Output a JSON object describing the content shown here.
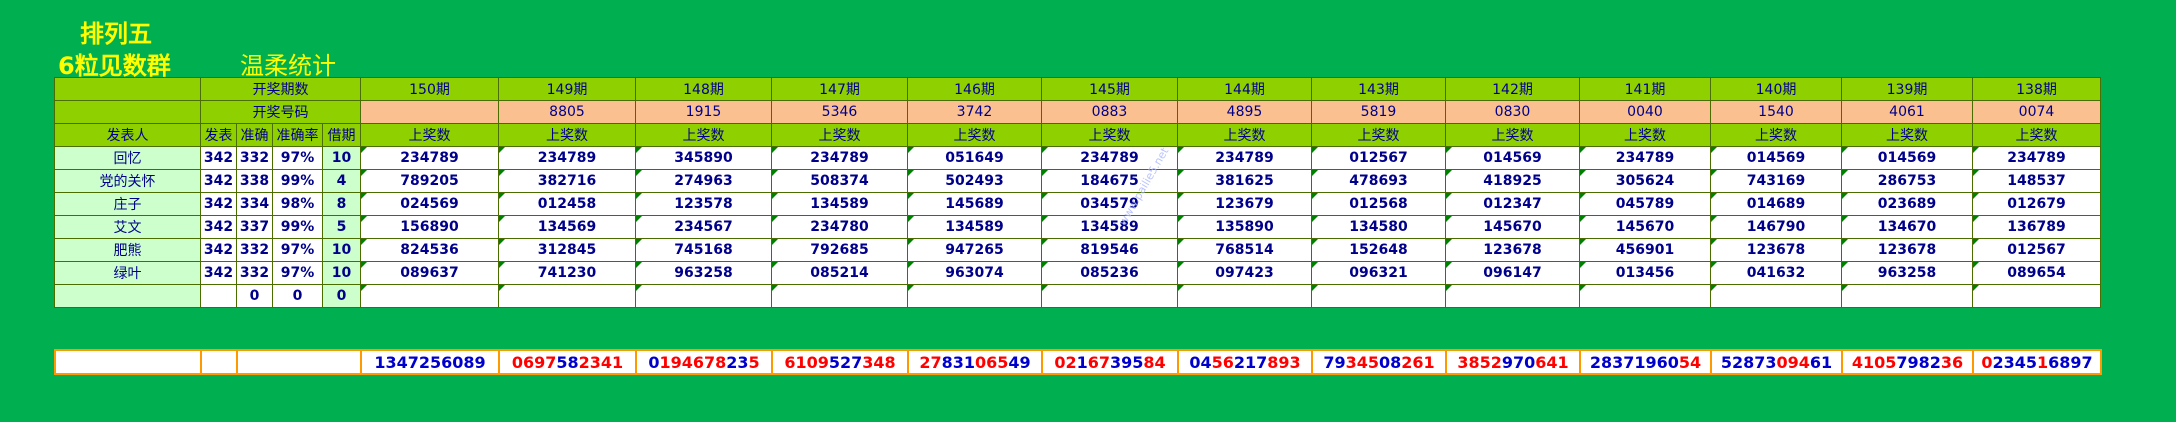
{
  "titles": {
    "main": "排列五",
    "sub": "6粒见数群",
    "tagline": "温柔统计"
  },
  "table": {
    "label_period": "开奖期数",
    "label_number": "开奖号码",
    "label_publisher": "发表人",
    "stat_headers": [
      "发表",
      "准确",
      "准确率",
      "借期"
    ],
    "prize_label": "上奖数",
    "periods": [
      "150期",
      "149期",
      "148期",
      "147期",
      "146期",
      "145期",
      "144期",
      "143期",
      "142期",
      "141期",
      "140期",
      "139期",
      "138期"
    ],
    "draws": [
      "",
      "8805",
      "1915",
      "5346",
      "3742",
      "0883",
      "4895",
      "5819",
      "0830",
      "0040",
      "1540",
      "4061",
      "0074"
    ],
    "rows": [
      {
        "name": "回忆",
        "stats": [
          "342",
          "332",
          "97%",
          "10"
        ],
        "preds": [
          "234789",
          "234789",
          "345890",
          "234789",
          "051649",
          "234789",
          "234789",
          "012567",
          "014569",
          "234789",
          "014569",
          "014569",
          "234789"
        ]
      },
      {
        "name": "党的关怀",
        "stats": [
          "342",
          "338",
          "99%",
          "4"
        ],
        "preds": [
          "789205",
          "382716",
          "274963",
          "508374",
          "502493",
          "184675",
          "381625",
          "478693",
          "418925",
          "305624",
          "743169",
          "286753",
          "148537"
        ]
      },
      {
        "name": "庄子",
        "stats": [
          "342",
          "334",
          "98%",
          "8"
        ],
        "preds": [
          "024569",
          "012458",
          "123578",
          "134589",
          "145689",
          "034579",
          "123679",
          "012568",
          "012347",
          "045789",
          "014689",
          "023689",
          "012679"
        ]
      },
      {
        "name": "艾文",
        "stats": [
          "342",
          "337",
          "99%",
          "5"
        ],
        "preds": [
          "156890",
          "134569",
          "234567",
          "234780",
          "134589",
          "134589",
          "135890",
          "134580",
          "145670",
          "145670",
          "146790",
          "134670",
          "136789"
        ]
      },
      {
        "name": "肥熊",
        "stats": [
          "342",
          "332",
          "97%",
          "10"
        ],
        "preds": [
          "824536",
          "312845",
          "745168",
          "792685",
          "947265",
          "819546",
          "768514",
          "152648",
          "123678",
          "456901",
          "123678",
          "123678",
          "012567"
        ]
      },
      {
        "name": "绿叶",
        "stats": [
          "342",
          "332",
          "97%",
          "10"
        ],
        "preds": [
          "089637",
          "741230",
          "963258",
          "085214",
          "963074",
          "085236",
          "097423",
          "096321",
          "096147",
          "013456",
          "041632",
          "963258",
          "089654"
        ]
      },
      {
        "name": "",
        "stats": [
          "",
          "0",
          "0",
          "0"
        ],
        "preds": [
          "",
          "",
          "",
          "",
          "",
          "",
          "",
          "",
          "",
          "",
          "",
          "",
          ""
        ]
      }
    ]
  },
  "bottom": {
    "sequences": [
      [
        {
          "t": "1347256089",
          "c": "b"
        }
      ],
      [
        {
          "t": "0697",
          "c": "r"
        },
        {
          "t": "58",
          "c": "b"
        },
        {
          "t": "2341",
          "c": "r"
        }
      ],
      [
        {
          "t": "0",
          "c": "b"
        },
        {
          "t": "194678",
          "c": "r"
        },
        {
          "t": "23",
          "c": "b"
        },
        {
          "t": "5",
          "c": "r"
        }
      ],
      [
        {
          "t": "6109",
          "c": "r"
        },
        {
          "t": "527",
          "c": "b"
        },
        {
          "t": "348",
          "c": "r"
        }
      ],
      [
        {
          "t": "27",
          "c": "r"
        },
        {
          "t": "831",
          "c": "b"
        },
        {
          "t": "065",
          "c": "r"
        },
        {
          "t": "49",
          "c": "b"
        }
      ],
      [
        {
          "t": "02",
          "c": "r"
        },
        {
          "t": "1",
          "c": "b"
        },
        {
          "t": "67",
          "c": "r"
        },
        {
          "t": "395",
          "c": "b"
        },
        {
          "t": "84",
          "c": "r"
        }
      ],
      [
        {
          "t": "04",
          "c": "b"
        },
        {
          "t": "56",
          "c": "r"
        },
        {
          "t": "217",
          "c": "b"
        },
        {
          "t": "893",
          "c": "r"
        }
      ],
      [
        {
          "t": "79",
          "c": "b"
        },
        {
          "t": "345",
          "c": "r"
        },
        {
          "t": "08",
          "c": "b"
        },
        {
          "t": "261",
          "c": "r"
        }
      ],
      [
        {
          "t": "3852",
          "c": "r"
        },
        {
          "t": "970",
          "c": "b"
        },
        {
          "t": "641",
          "c": "r"
        }
      ],
      [
        {
          "t": "28371960",
          "c": "b"
        },
        {
          "t": "54",
          "c": "r"
        }
      ],
      [
        {
          "t": "52873",
          "c": "b"
        },
        {
          "t": "094",
          "c": "r"
        },
        {
          "t": "61",
          "c": "b"
        }
      ],
      [
        {
          "t": "4105",
          "c": "r"
        },
        {
          "t": "7982",
          "c": "b"
        },
        {
          "t": "36",
          "c": "r"
        }
      ],
      [
        {
          "t": "0",
          "c": "r"
        },
        {
          "t": "2345",
          "c": "b"
        },
        {
          "t": "1",
          "c": "r"
        },
        {
          "t": "6897",
          "c": "b"
        }
      ]
    ]
  },
  "watermark": "www.pailie5.net"
}
